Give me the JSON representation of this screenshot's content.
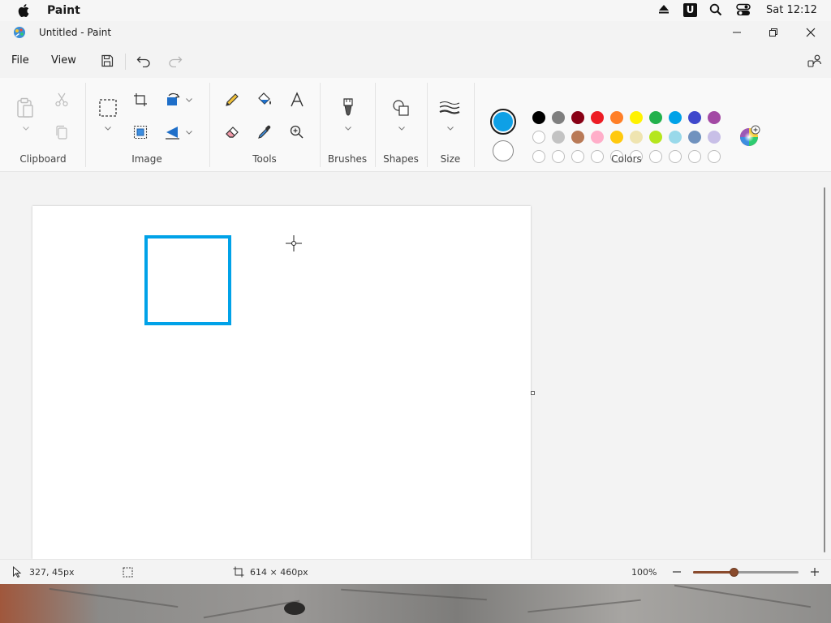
{
  "mac_menubar": {
    "app_name": "Paint",
    "clock": "Sat 12:12",
    "icons": [
      "apple-icon",
      "eject-icon",
      "u-badge-icon",
      "spotlight-search-icon",
      "control-center-icon"
    ],
    "u_badge": "U"
  },
  "window": {
    "title": "Untitled - Paint",
    "controls": [
      "minimize-icon",
      "restore-icon",
      "close-icon"
    ]
  },
  "menubar": {
    "file": "File",
    "view": "View",
    "icons": [
      "save-icon",
      "undo-icon",
      "redo-icon",
      "share-account-icon"
    ]
  },
  "ribbon": {
    "groups": {
      "clipboard": "Clipboard",
      "image": "Image",
      "tools": "Tools",
      "brushes": "Brushes",
      "shapes": "Shapes",
      "size": "Size",
      "colors": "Colors"
    },
    "colors": {
      "primary": "#0ea0e6",
      "secondary": "#ffffff",
      "palette_row1": [
        "#000000",
        "#7f7f7f",
        "#880015",
        "#ed1c24",
        "#ff7f27",
        "#fff200",
        "#22b14c",
        "#00a2e8",
        "#3f48cc",
        "#a349a4"
      ],
      "palette_row2": [
        "#ffffff",
        "#c3c3c3",
        "#b97a57",
        "#ffaec9",
        "#ffc90e",
        "#efe4b0",
        "#b5e61d",
        "#99d9ea",
        "#7092be",
        "#c8bfe7"
      ],
      "palette_row3_empty": 10
    }
  },
  "canvas": {
    "stroke_color": "#00a2e8"
  },
  "status": {
    "cursor_pos": "327, 45px",
    "canvas_size": "614 × 460px",
    "zoom": "100%",
    "zoom_fraction": 0.39
  }
}
